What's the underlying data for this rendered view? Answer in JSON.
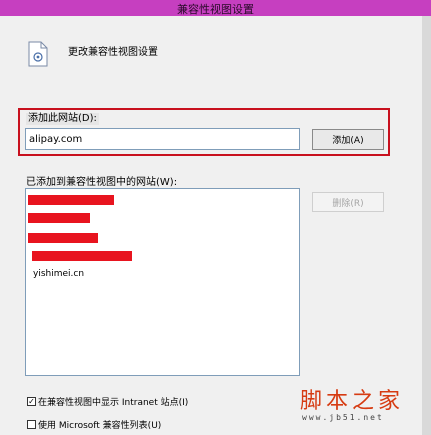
{
  "window": {
    "title": "兼容性视图设置"
  },
  "header": {
    "title": "更改兼容性视图设置",
    "icon": "document-settings-icon"
  },
  "add_site": {
    "label": "添加此网站(D):",
    "value": "alipay.com",
    "button_label": "添加(A)"
  },
  "site_list": {
    "label": "已添加到兼容性视图中的网站(W):",
    "visible_entry": "yishimei.cn",
    "remove_label": "删除(R)"
  },
  "options": {
    "intranet_label": "在兼容性视图中显示 Intranet 站点(I)",
    "intranet_checked": true,
    "ms_list_label": "使用 Microsoft 兼容性列表(U)",
    "ms_list_checked": false
  },
  "watermark": {
    "title": "脚本之家",
    "url": "www.jb51.net"
  },
  "colors": {
    "titlebar": "#c63fc0",
    "highlight": "#c8101e",
    "redaction": "#e8141f"
  }
}
